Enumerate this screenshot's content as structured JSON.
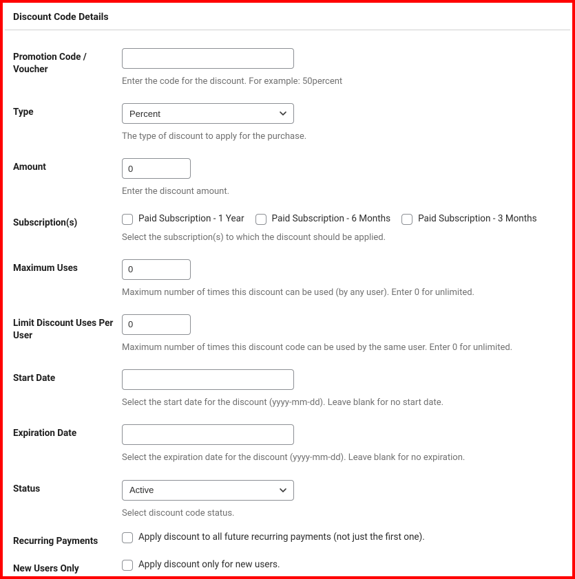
{
  "panel": {
    "title": "Discount Code Details"
  },
  "fields": {
    "promo": {
      "label": "Promotion Code / Voucher",
      "value": "",
      "help": "Enter the code for the discount. For example: 50percent"
    },
    "type": {
      "label": "Type",
      "selected": "Percent",
      "help": "The type of discount to apply for the purchase."
    },
    "amount": {
      "label": "Amount",
      "value": "0",
      "help": "Enter the discount amount."
    },
    "subscriptions": {
      "label": "Subscription(s)",
      "options": [
        {
          "label": "Paid Subscription - 1 Year"
        },
        {
          "label": "Paid Subscription - 6 Months"
        },
        {
          "label": "Paid Subscription - 3 Months"
        }
      ],
      "help": "Select the subscription(s) to which the discount should be applied."
    },
    "max_uses": {
      "label": "Maximum Uses",
      "value": "0",
      "help": "Maximum number of times this discount can be used (by any user). Enter 0 for unlimited."
    },
    "limit_per_user": {
      "label": "Limit Discount Uses Per User",
      "value": "0",
      "help": "Maximum number of times this discount code can be used by the same user. Enter 0 for unlimited."
    },
    "start_date": {
      "label": "Start Date",
      "value": "",
      "help": "Select the start date for the discount (yyyy-mm-dd). Leave blank for no start date."
    },
    "expiration_date": {
      "label": "Expiration Date",
      "value": "",
      "help": "Select the expiration date for the discount (yyyy-mm-dd). Leave blank for no expiration."
    },
    "status": {
      "label": "Status",
      "selected": "Active",
      "help": "Select discount code status."
    },
    "recurring": {
      "label": "Recurring Payments",
      "option_label": "Apply discount to all future recurring payments (not just the first one)."
    },
    "new_users": {
      "label": "New Users Only",
      "option_label": "Apply discount only for new users."
    }
  }
}
